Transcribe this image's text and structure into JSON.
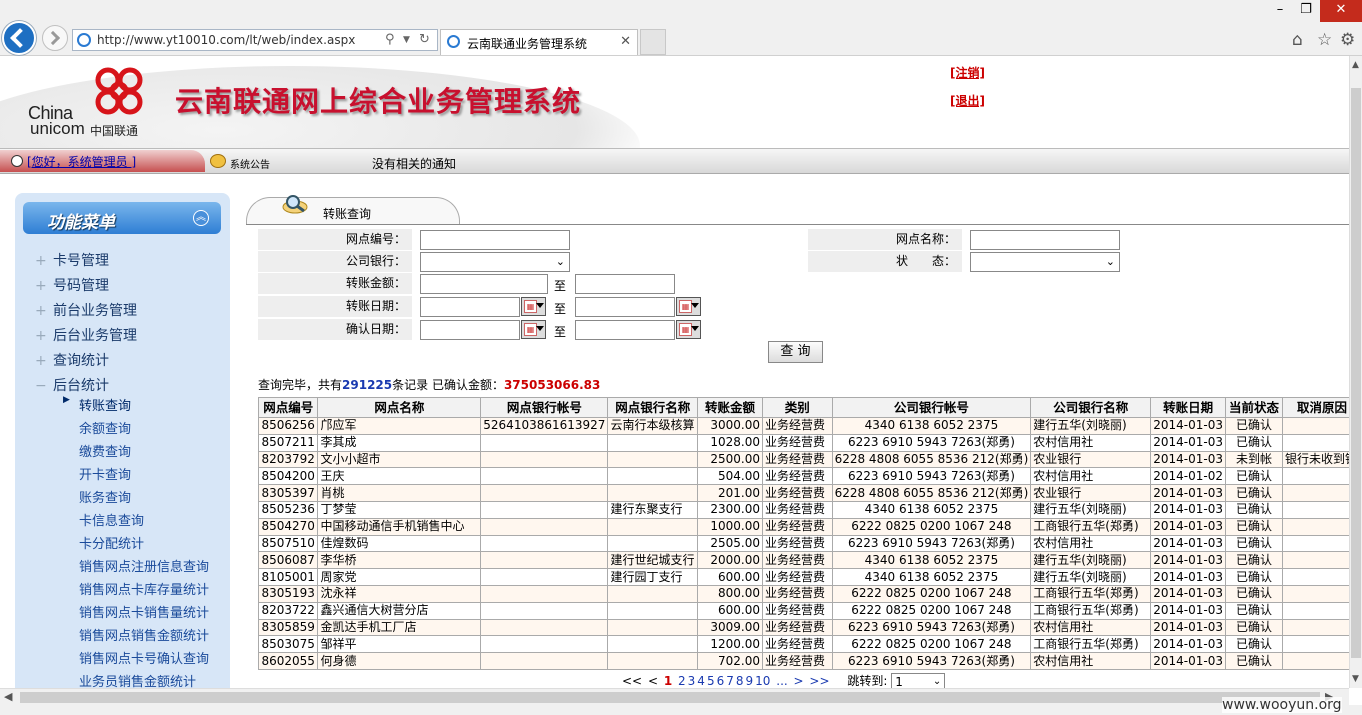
{
  "browser": {
    "url": "http://www.yt10010.com/lt/web/index.aspx",
    "tab_title": "云南联通业务管理系统",
    "search_icon": "search-icon",
    "refresh_icon": "refresh-icon"
  },
  "header": {
    "logo_en_line1": "China",
    "logo_en_line2": "unicom",
    "logo_cn": "中国联通",
    "title": "云南联通网上综合业务管理系统",
    "link_cancel": "[注销]",
    "link_exit": "[退出]",
    "brand_color": "#c8102e"
  },
  "statusbar": {
    "greeting": "[您好，系统管理员 ]",
    "notice_label": "系统公告",
    "notice_text": "没有相关的通知"
  },
  "sidebar": {
    "title": "功能菜单",
    "items": [
      {
        "label": "卡号管理"
      },
      {
        "label": "号码管理"
      },
      {
        "label": "前台业务管理"
      },
      {
        "label": "后台业务管理"
      },
      {
        "label": "查询统计"
      },
      {
        "label": "后台统计"
      }
    ],
    "subitems": [
      {
        "label": "转账查询"
      },
      {
        "label": "余额查询"
      },
      {
        "label": "缴费查询"
      },
      {
        "label": "开卡查询"
      },
      {
        "label": "账务查询"
      },
      {
        "label": "卡信息查询"
      },
      {
        "label": "卡分配统计"
      },
      {
        "label": "销售网点注册信息查询"
      },
      {
        "label": "销售网点卡库存量统计"
      },
      {
        "label": "销售网点卡销售量统计"
      },
      {
        "label": "销售网点销售金额统计"
      },
      {
        "label": "销售网点卡号确认查询"
      },
      {
        "label": "业务员销售金额统计"
      }
    ]
  },
  "page": {
    "tab_label": "转账查询"
  },
  "form": {
    "outlet_code_label": "网点编号：",
    "outlet_name_label": "网点名称：",
    "company_bank_label": "公司银行：",
    "status_label": "状　　态：",
    "amount_label": "转账金额：",
    "transfer_date_label": "转账日期：",
    "confirm_date_label": "确认日期：",
    "to_label": "至",
    "query_button": "查 询"
  },
  "summary": {
    "prefix": "查询完毕，共有",
    "count": "291225",
    "middle": "条记录 已确认金额：",
    "amount": "375053066.83"
  },
  "table": {
    "headers": [
      "网点编号",
      "网点名称",
      "网点银行帐号",
      "网点银行名称",
      "转账金额",
      "类别",
      "公司银行帐号",
      "公司银行名称",
      "转账日期",
      "当前状态",
      "取消原因"
    ],
    "rows": [
      [
        "8506256",
        "邝应军",
        "5264103861613927",
        "云南行本级核算",
        "3000.00",
        "业务经营费",
        "4340 6138 6052 2375",
        "建行五华(刘晓丽)",
        "2014-01-03",
        "已确认",
        ""
      ],
      [
        "8507211",
        "李其成",
        "",
        "",
        "1028.00",
        "业务经营费",
        "6223 6910 5943 7263(郑勇)",
        "农村信用社",
        "2014-01-03",
        "已确认",
        ""
      ],
      [
        "8203792",
        "文小小超市",
        "",
        "",
        "2500.00",
        "业务经营费",
        "6228 4808 6055 8536 212(郑勇)",
        "农业银行",
        "2014-01-03",
        "未到帐",
        "银行未收到钱"
      ],
      [
        "8504200",
        "王庆",
        "",
        "",
        "504.00",
        "业务经营费",
        "6223 6910 5943 7263(郑勇)",
        "农村信用社",
        "2014-01-02",
        "已确认",
        ""
      ],
      [
        "8305397",
        "肖桃",
        "",
        "",
        "201.00",
        "业务经营费",
        "6228 4808 6055 8536 212(郑勇)",
        "农业银行",
        "2014-01-03",
        "已确认",
        ""
      ],
      [
        "8505236",
        "丁梦莹",
        "",
        "建行东聚支行",
        "2300.00",
        "业务经营费",
        "4340 6138 6052 2375",
        "建行五华(刘晓丽)",
        "2014-01-03",
        "已确认",
        ""
      ],
      [
        "8504270",
        "中国移动通信手机销售中心",
        "",
        "",
        "1000.00",
        "业务经营费",
        "6222 0825 0200 1067 248",
        "工商银行五华(郑勇)",
        "2014-01-03",
        "已确认",
        ""
      ],
      [
        "8507510",
        "佳煌数码",
        "",
        "",
        "2505.00",
        "业务经营费",
        "6223 6910 5943 7263(郑勇)",
        "农村信用社",
        "2014-01-03",
        "已确认",
        ""
      ],
      [
        "8506087",
        "李华桥",
        "",
        "建行世纪城支行",
        "2000.00",
        "业务经营费",
        "4340 6138 6052 2375",
        "建行五华(刘晓丽)",
        "2014-01-03",
        "已确认",
        ""
      ],
      [
        "8105001",
        "周家党",
        "",
        "建行园丁支行",
        "600.00",
        "业务经营费",
        "4340 6138 6052 2375",
        "建行五华(刘晓丽)",
        "2014-01-03",
        "已确认",
        ""
      ],
      [
        "8305193",
        "沈永祥",
        "",
        "",
        "800.00",
        "业务经营费",
        "6222 0825 0200 1067 248",
        "工商银行五华(郑勇)",
        "2014-01-03",
        "已确认",
        ""
      ],
      [
        "8203722",
        "鑫兴通信大树营分店",
        "",
        "",
        "600.00",
        "业务经营费",
        "6222 0825 0200 1067 248",
        "工商银行五华(郑勇)",
        "2014-01-03",
        "已确认",
        ""
      ],
      [
        "8305859",
        "金凯达手机工厂店",
        "",
        "",
        "3009.00",
        "业务经营费",
        "6223 6910 5943 7263(郑勇)",
        "农村信用社",
        "2014-01-03",
        "已确认",
        ""
      ],
      [
        "8503075",
        "邹祥平",
        "",
        "",
        "1200.00",
        "业务经营费",
        "6222 0825 0200 1067 248",
        "工商银行五华(郑勇)",
        "2014-01-03",
        "已确认",
        ""
      ],
      [
        "8602055",
        "何身德",
        "",
        "",
        "702.00",
        "业务经营费",
        "6223 6910 5943 7263(郑勇)",
        "农村信用社",
        "2014-01-03",
        "已确认",
        ""
      ]
    ]
  },
  "pager": {
    "first": "<<",
    "prev": "<",
    "current": "1",
    "pages": [
      "2",
      "3",
      "4",
      "5",
      "6",
      "7",
      "8",
      "9",
      "10"
    ],
    "ellipsis": "...",
    "next": ">",
    "last": ">>",
    "jump_label": "跳转到:",
    "jump_value": "1"
  },
  "watermark": "www.wooyun.org"
}
